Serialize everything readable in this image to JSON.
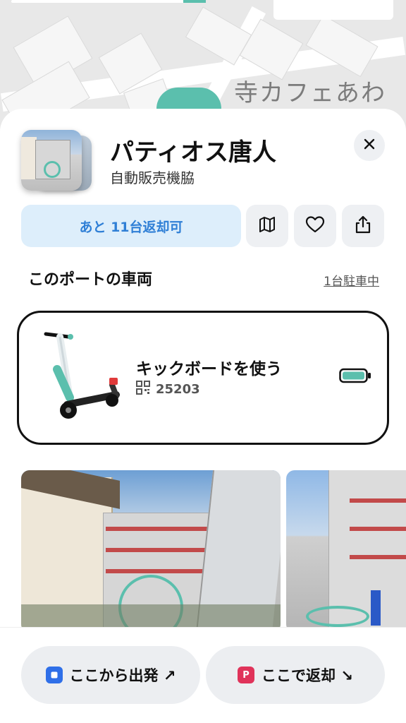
{
  "map": {
    "place_label": "寺カフェあわ"
  },
  "port": {
    "name": "パティオス唐人",
    "sublabel": "自動販売機脇",
    "return_capacity": "あと 11台返却可"
  },
  "vehicles_section": {
    "title": "このポートの車両",
    "parked_count": "1台駐車中",
    "items": [
      {
        "action_label": "キックボードを使う",
        "id": "25203",
        "battery_level": 0.85
      }
    ]
  },
  "bottom_actions": {
    "depart_label": "ここから出発 ↗",
    "return_label": "ここで返却 ↘",
    "return_badge": "P"
  },
  "colors": {
    "accent_teal": "#5bbfad",
    "link_blue": "#2f7fd6",
    "depart_badge": "#2f6fe8",
    "return_badge": "#e0335a"
  },
  "icons": [
    "close-icon",
    "map-icon",
    "heart-icon",
    "share-icon",
    "qr-code-icon",
    "battery-icon"
  ]
}
